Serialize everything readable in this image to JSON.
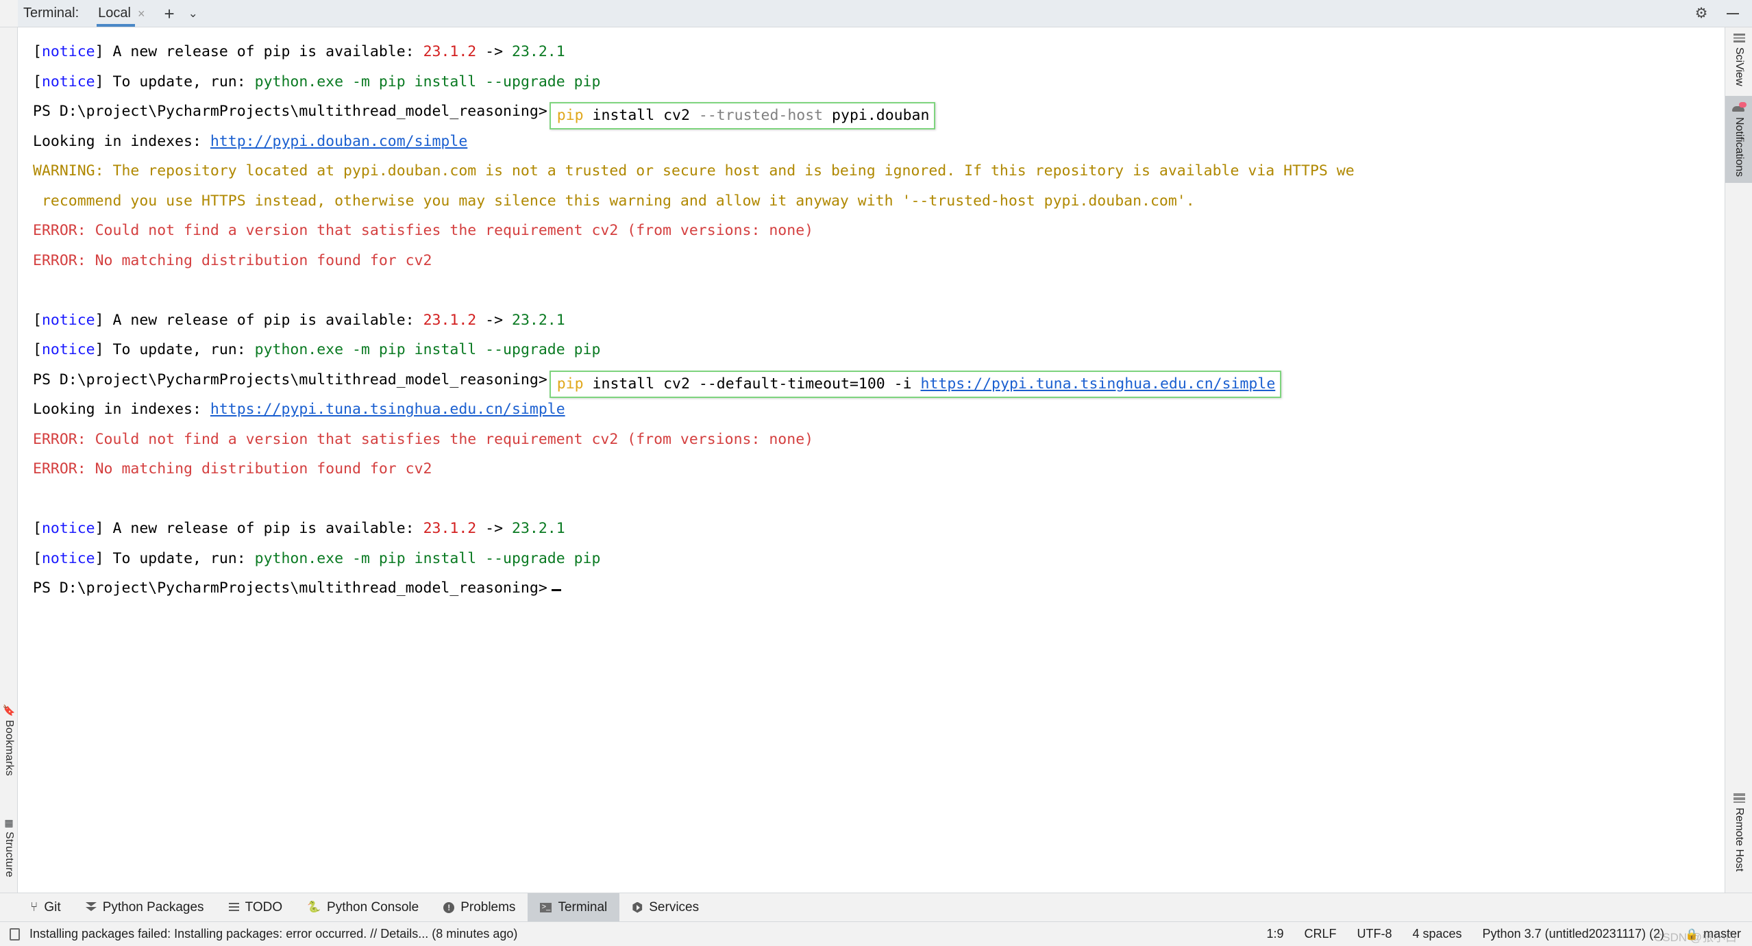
{
  "window": {
    "terminal_label": "Terminal:",
    "tab_name": "Local",
    "close_glyph": "×",
    "plus_glyph": "+",
    "chevron_glyph": "⌄",
    "gear_glyph": "⚙",
    "minimize_name": "minimize"
  },
  "left_strip": {
    "bookmarks": "Bookmarks",
    "structure": "Structure"
  },
  "right_strip": {
    "sciview": "SciView",
    "notifications": "Notifications",
    "remote_host": "Remote Host"
  },
  "terminal": {
    "lines": [
      {
        "id": "l1",
        "segments": [
          {
            "t": "[",
            "c": "c-black"
          },
          {
            "t": "notice",
            "c": "c-blue"
          },
          {
            "t": "] A new release of pip is available: ",
            "c": "c-black"
          },
          {
            "t": "23.1.2",
            "c": "c-red"
          },
          {
            "t": " -> ",
            "c": "c-black"
          },
          {
            "t": "23.2.1",
            "c": "c-green"
          }
        ]
      },
      {
        "id": "l2",
        "segments": [
          {
            "t": "[",
            "c": "c-black"
          },
          {
            "t": "notice",
            "c": "c-blue"
          },
          {
            "t": "] To update, run: ",
            "c": "c-black"
          },
          {
            "t": "python.exe -m pip install --upgrade pip",
            "c": "c-green"
          }
        ]
      },
      {
        "id": "l3",
        "prompt": "PS D:\\project\\PycharmProjects\\multithread_model_reasoning>",
        "boxed_command": [
          {
            "t": "pip",
            "c": "c-cmdkey"
          },
          {
            "t": " install cv2 ",
            "c": "c-black"
          },
          {
            "t": "--trusted-host",
            "c": "c-cmdflag"
          },
          {
            "t": " pypi.douban",
            "c": "c-black"
          }
        ]
      },
      {
        "id": "l4",
        "segments": [
          {
            "t": "Looking in indexes: ",
            "c": "c-black"
          },
          {
            "t": "http://pypi.douban.com/simple",
            "c": "c-link"
          }
        ]
      },
      {
        "id": "l5",
        "wrapped": true,
        "segments": [
          {
            "t": "WARNING: The repository located at pypi.douban.com is not a trusted or secure host and is being ignored. If this repository is available via HTTPS we\n recommend you use HTTPS instead, otherwise you may silence this warning and allow it anyway with '--trusted-host pypi.douban.com'.",
            "c": "c-warn"
          }
        ]
      },
      {
        "id": "l6",
        "segments": [
          {
            "t": "ERROR: Could not find a version that satisfies the requirement cv2 (from versions: none)",
            "c": "c-err"
          }
        ]
      },
      {
        "id": "l7",
        "segments": [
          {
            "t": "ERROR: No matching distribution found for cv2",
            "c": "c-err"
          }
        ]
      },
      {
        "id": "l8",
        "segments": []
      },
      {
        "id": "l9",
        "segments": [
          {
            "t": "[",
            "c": "c-black"
          },
          {
            "t": "notice",
            "c": "c-blue"
          },
          {
            "t": "] A new release of pip is available: ",
            "c": "c-black"
          },
          {
            "t": "23.1.2",
            "c": "c-red"
          },
          {
            "t": " -> ",
            "c": "c-black"
          },
          {
            "t": "23.2.1",
            "c": "c-green"
          }
        ]
      },
      {
        "id": "l10",
        "segments": [
          {
            "t": "[",
            "c": "c-black"
          },
          {
            "t": "notice",
            "c": "c-blue"
          },
          {
            "t": "] To update, run: ",
            "c": "c-black"
          },
          {
            "t": "python.exe -m pip install --upgrade pip",
            "c": "c-green"
          }
        ]
      },
      {
        "id": "l11",
        "prompt": "PS D:\\project\\PycharmProjects\\multithread_model_reasoning>",
        "boxed_command": [
          {
            "t": "pip",
            "c": "c-cmdkey"
          },
          {
            "t": " install cv2 ",
            "c": "c-black"
          },
          {
            "t": "--default-timeout=100",
            "c": "c-black"
          },
          {
            "t": " -i ",
            "c": "c-black"
          },
          {
            "t": "https://pypi.tuna.tsinghua.edu.cn/simple",
            "c": "c-link"
          }
        ]
      },
      {
        "id": "l12",
        "segments": [
          {
            "t": "Looking in indexes: ",
            "c": "c-black"
          },
          {
            "t": "https://pypi.tuna.tsinghua.edu.cn/simple",
            "c": "c-link"
          }
        ]
      },
      {
        "id": "l13",
        "segments": [
          {
            "t": "ERROR: Could not find a version that satisfies the requirement cv2 (from versions: none)",
            "c": "c-err"
          }
        ]
      },
      {
        "id": "l14",
        "segments": [
          {
            "t": "ERROR: No matching distribution found for cv2",
            "c": "c-err"
          }
        ]
      },
      {
        "id": "l15",
        "segments": []
      },
      {
        "id": "l16",
        "segments": [
          {
            "t": "[",
            "c": "c-black"
          },
          {
            "t": "notice",
            "c": "c-blue"
          },
          {
            "t": "] A new release of pip is available: ",
            "c": "c-black"
          },
          {
            "t": "23.1.2",
            "c": "c-red"
          },
          {
            "t": " -> ",
            "c": "c-black"
          },
          {
            "t": "23.2.1",
            "c": "c-green"
          }
        ]
      },
      {
        "id": "l17",
        "segments": [
          {
            "t": "[",
            "c": "c-black"
          },
          {
            "t": "notice",
            "c": "c-blue"
          },
          {
            "t": "] To update, run: ",
            "c": "c-black"
          },
          {
            "t": "python.exe -m pip install --upgrade pip",
            "c": "c-green"
          }
        ]
      },
      {
        "id": "l18",
        "prompt_only": "PS D:\\project\\PycharmProjects\\multithread_model_reasoning>",
        "cursor": true
      }
    ]
  },
  "tool_tabs": [
    {
      "label": "Git",
      "icon": "git-icon",
      "active": false
    },
    {
      "label": "Python Packages",
      "icon": "packages-icon",
      "active": false
    },
    {
      "label": "TODO",
      "icon": "todo-icon",
      "active": false
    },
    {
      "label": "Python Console",
      "icon": "python-icon",
      "active": false
    },
    {
      "label": "Problems",
      "icon": "problems-icon",
      "active": false
    },
    {
      "label": "Terminal",
      "icon": "terminal-icon",
      "active": true
    },
    {
      "label": "Services",
      "icon": "services-icon",
      "active": false
    }
  ],
  "status_bar": {
    "message": "Installing packages failed: Installing packages: error occurred. // Details... (8 minutes ago)",
    "caret": "1:9",
    "line_separator": "CRLF",
    "encoding": "UTF-8",
    "indent": "4 spaces",
    "interpreter": "Python 3.7 (untitled20231117) (2)",
    "branch": "master",
    "lock_glyph": "🔒",
    "watermark": "CSDN @张小白"
  }
}
